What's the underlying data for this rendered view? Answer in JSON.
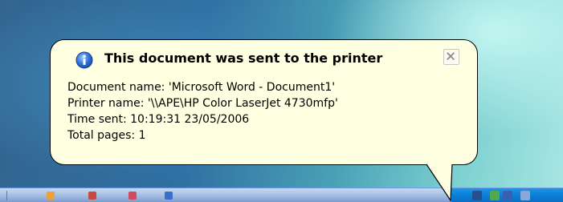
{
  "notification": {
    "title": "This document was sent to the printer",
    "lines": [
      "Document name: 'Microsoft Word - Document1'",
      "Printer name: '\\\\APE\\HP Color LaserJet 4730mfp'",
      "Time sent: 10:19:31  23/05/2006",
      "Total pages: 1"
    ],
    "close_icon": "close-icon",
    "info_icon": "info-icon"
  },
  "colors": {
    "balloon_bg": "#ffffe1",
    "info_blue": "#1f5fcf",
    "taskbar_blue": "#2453ad"
  }
}
